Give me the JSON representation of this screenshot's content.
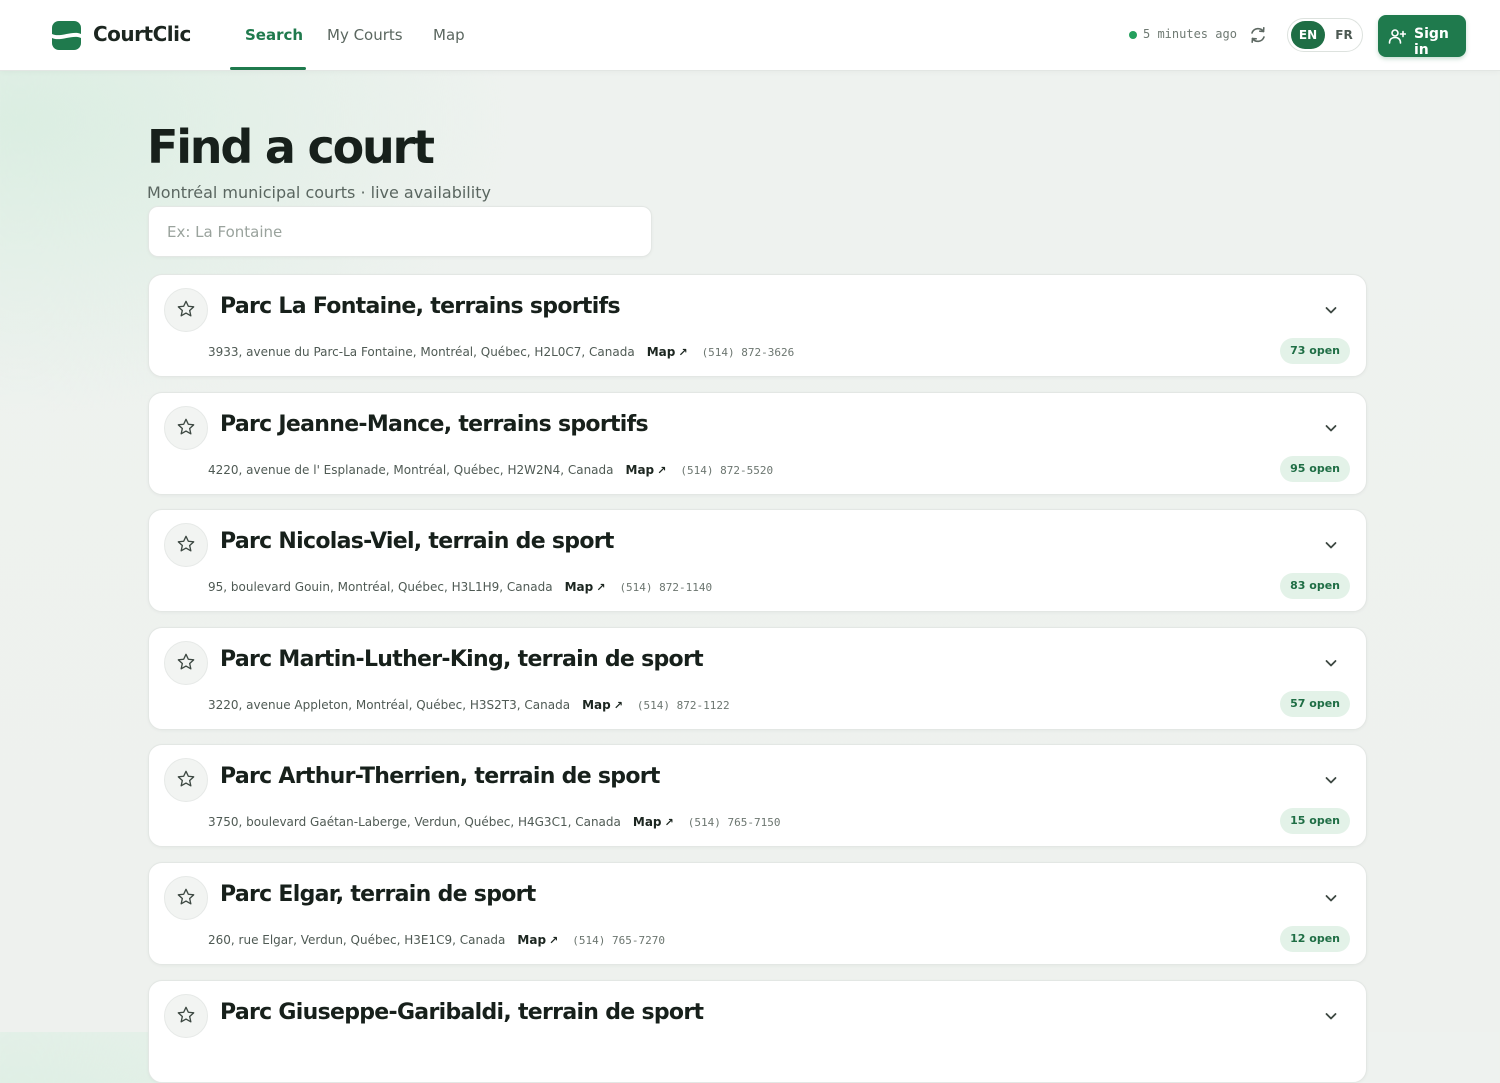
{
  "app": {
    "name": "CourtClic",
    "colors": {
      "accent": "#1f7a4d",
      "badge_bg": "#e3f2e8",
      "status_dot": "#24a05d"
    }
  },
  "nav": {
    "tabs": [
      {
        "label": "Search",
        "active": true
      },
      {
        "label": "My Courts",
        "active": false
      },
      {
        "label": "Map",
        "active": false
      }
    ]
  },
  "header": {
    "status_text": "5 minutes ago",
    "refresh_icon": "refresh-icon",
    "languages": [
      {
        "code": "EN",
        "active": true
      },
      {
        "code": "FR",
        "active": false
      }
    ],
    "signin_label": "Sign in",
    "signin_icon": "user-plus-icon"
  },
  "hero": {
    "title": "Find a court",
    "subtitle": "Montréal municipal courts · live availability",
    "search_placeholder": "Ex: La Fontaine",
    "search_value": ""
  },
  "courts": [
    {
      "name": "Parc La Fontaine, terrains sportifs",
      "address": "3933, avenue du Parc-La Fontaine, Montréal, Québec, H2L0C7, Canada",
      "map_label": "Map",
      "phone": "(514) 872-3626",
      "open": "73 open",
      "favorite": false
    },
    {
      "name": "Parc Jeanne-Mance, terrains sportifs",
      "address": "4220, avenue de l' Esplanade, Montréal, Québec, H2W2N4, Canada",
      "map_label": "Map",
      "phone": "(514) 872-5520",
      "open": "95 open",
      "favorite": false
    },
    {
      "name": "Parc Nicolas-Viel, terrain de sport",
      "address": "95, boulevard Gouin, Montréal, Québec, H3L1H9, Canada",
      "map_label": "Map",
      "phone": "(514) 872-1140",
      "open": "83 open",
      "favorite": false
    },
    {
      "name": "Parc Martin-Luther-King, terrain de sport",
      "address": "3220, avenue Appleton, Montréal, Québec, H3S2T3, Canada",
      "map_label": "Map",
      "phone": "(514) 872-1122",
      "open": "57 open",
      "favorite": false
    },
    {
      "name": "Parc Arthur-Therrien, terrain de sport",
      "address": "3750, boulevard Gaétan-Laberge, Verdun, Québec, H4G3C1, Canada",
      "map_label": "Map",
      "phone": "(514) 765-7150",
      "open": "15 open",
      "favorite": false
    },
    {
      "name": "Parc Elgar, terrain de sport",
      "address": "260, rue Elgar, Verdun, Québec, H3E1C9, Canada",
      "map_label": "Map",
      "phone": "(514) 765-7270",
      "open": "12 open",
      "favorite": false
    },
    {
      "name": "Parc Giuseppe-Garibaldi, terrain de sport",
      "address": "",
      "map_label": "",
      "phone": "",
      "open": "",
      "favorite": false
    }
  ]
}
